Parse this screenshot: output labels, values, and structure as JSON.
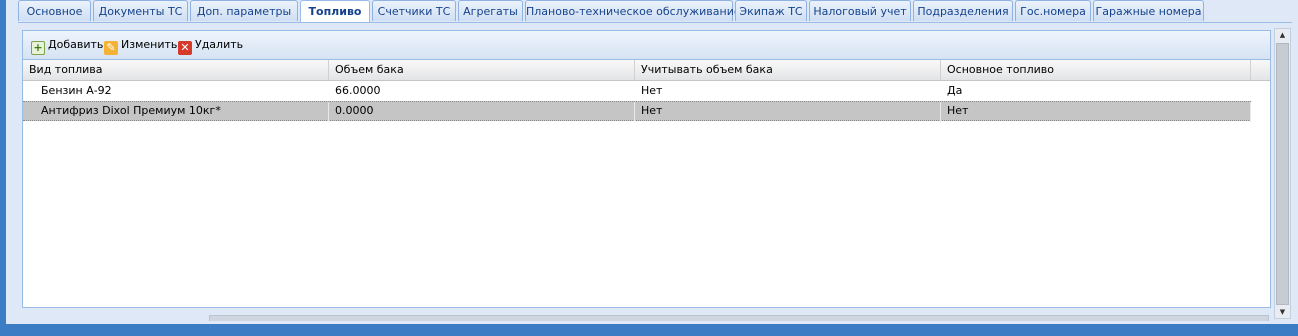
{
  "tabs": [
    {
      "label": "Основное",
      "active": false
    },
    {
      "label": "Документы ТС",
      "active": false
    },
    {
      "label": "Доп. параметры",
      "active": false
    },
    {
      "label": "Топливо",
      "active": true
    },
    {
      "label": "Счетчики ТС",
      "active": false
    },
    {
      "label": "Агрегаты",
      "active": false
    },
    {
      "label": "Планово-техническое обслуживание",
      "active": false
    },
    {
      "label": "Экипаж ТС",
      "active": false
    },
    {
      "label": "Налоговый учет",
      "active": false
    },
    {
      "label": "Подразделения",
      "active": false
    },
    {
      "label": "Гос.номера",
      "active": false
    },
    {
      "label": "Гаражные номера",
      "active": false
    }
  ],
  "toolbar": {
    "add_label": "Добавить",
    "edit_label": "Изменить",
    "delete_label": "Удалить"
  },
  "grid": {
    "columns": [
      "Вид топлива",
      "Объем бака",
      "Учитывать объем бака",
      "Основное топливо"
    ],
    "rows": [
      {
        "fuel": "Бензин А-92",
        "volume": "66.0000",
        "consider": "Нет",
        "main": "Да",
        "selected": false
      },
      {
        "fuel": "Антифриз Dixol Премиум 10кг*",
        "volume": "0.0000",
        "consider": "Нет",
        "main": "Нет",
        "selected": true
      }
    ]
  },
  "colors": {
    "accent": "#15428b",
    "frame": "#3b7cc4",
    "selection": "#c5c5c5"
  },
  "icons": {
    "add": "add-icon",
    "edit": "pencil-icon",
    "delete": "delete-icon"
  }
}
